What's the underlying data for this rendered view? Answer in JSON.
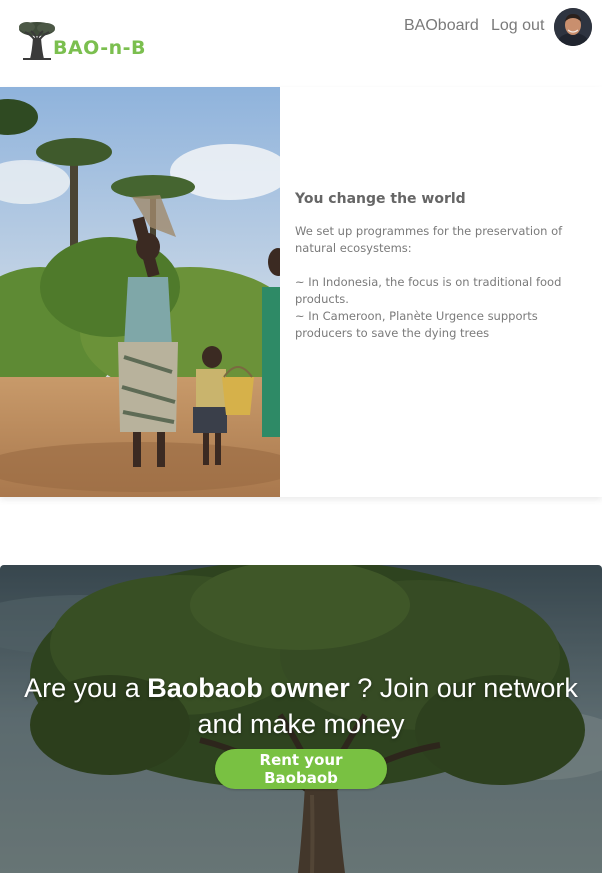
{
  "header": {
    "logo_text": "BAO-n-B",
    "nav": {
      "baoboard": "BAOboard",
      "logout": "Log out"
    },
    "avatar_icon": "user-avatar"
  },
  "feature": {
    "title": "You change the world",
    "intro": "We set up programmes for the preservation of natural ecosystems:",
    "bullet_1": "~ In Indonesia, the focus is on traditional food products.",
    "bullet_2": "~ In Cameroon, Planète Urgence supports producers to save the dying trees"
  },
  "hero": {
    "heading_pre": "Are you a ",
    "heading_bold": "Baobaob owner",
    "heading_post": " ? Join our network and make money",
    "button_label": "Rent your Baobaob"
  },
  "colors": {
    "accent_green": "#79c142",
    "logo_green": "#7bbf4f",
    "text_gray": "#7a7a7a"
  }
}
